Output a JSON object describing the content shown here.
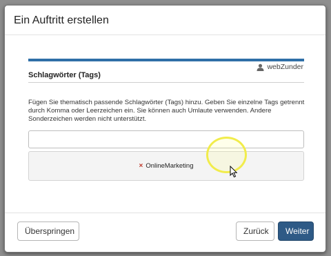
{
  "dialog": {
    "title": "Ein Auftritt erstellen"
  },
  "progress": {
    "value": 1.0,
    "color": "#2f6fa7"
  },
  "author": {
    "icon": "user-icon",
    "name": "webZunder"
  },
  "section": {
    "title": "Schlagwörter (Tags)",
    "description": "Fügen Sie thematisch passende Schlagwörter (Tags) hinzu. Geben Sie einzelne Tags getrennt durch Komma oder Leerzeichen ein. Sie können auch Umlaute verwenden. Andere Sonderzeichen werden nicht unterstützt."
  },
  "tag_input": {
    "value": "",
    "placeholder": ""
  },
  "tags": [
    {
      "label": "OnlineMarketing",
      "remove_icon": "close-icon",
      "remove_glyph": "×"
    }
  ],
  "footer": {
    "skip_label": "Überspringen",
    "back_label": "Zurück",
    "next_label": "Weiter"
  },
  "colors": {
    "primary": "#2e5a86",
    "highlight": "#f1ec4b",
    "remove": "#c0392b"
  }
}
